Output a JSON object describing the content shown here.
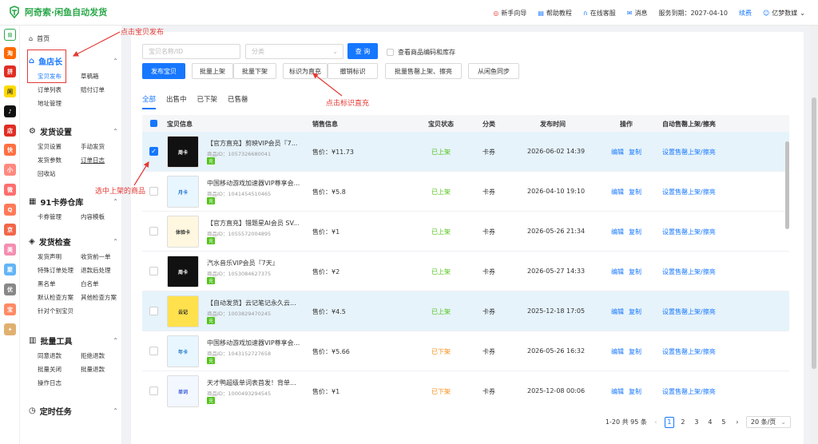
{
  "app": {
    "title": "阿奇索·闲鱼自动发货"
  },
  "topnav": {
    "guide": "新手向导",
    "help": "帮助教程",
    "service": "在线客服",
    "messages": "消息",
    "expiry": "服务到期：2027-04-10",
    "renew": "续费",
    "user": "亿梦数媒"
  },
  "rail": {
    "items": [
      "淘",
      "拼",
      "闲",
      "抖",
      "店",
      "快",
      "小",
      "微",
      "Q",
      "京",
      "美",
      "聚",
      "优",
      "宝"
    ]
  },
  "sidebar": {
    "home": "首页",
    "fish": {
      "title": "鱼店长",
      "items": [
        "宝贝发布",
        "草稿箱",
        "订单列表",
        "赔付订单",
        "地址管理"
      ]
    },
    "ship": {
      "title": "发货设置",
      "items": [
        "宝贝设置",
        "手动发货",
        "发货参数",
        "订单日志",
        "回收站"
      ]
    },
    "card": {
      "title": "91卡券仓库",
      "items": [
        "卡券管理",
        "内容模板"
      ]
    },
    "check": {
      "title": "发货检查",
      "items": [
        "发货声明",
        "收货前一单",
        "特殊订单处理",
        "退款后处理",
        "黑名单",
        "白名单",
        "默认检查方案",
        "其他检查方案",
        "针对个别宝贝"
      ]
    },
    "batch": {
      "title": "批量工具",
      "items": [
        "同意退款",
        "拒绝退款",
        "批量关闭",
        "批量退款",
        "操作日志"
      ]
    },
    "timer": {
      "title": "定时任务"
    }
  },
  "filters": {
    "name_placeholder": "宝贝名称/ID",
    "category_placeholder": "分类",
    "search": "查 询",
    "show_code": "查看商品编码和库存"
  },
  "toolbar": {
    "publish": "发布宝贝",
    "bulk_on": "批量上架",
    "bulk_off": "批量下架",
    "mark_direct": "标识为直充",
    "unmark": "撤销标识",
    "bulk_sold": "批量售罄上架、擦亮",
    "sync": "从闲鱼同步"
  },
  "tabs": [
    "全部",
    "出售中",
    "已下架",
    "已售罄"
  ],
  "table": {
    "headers": {
      "info": "宝贝信息",
      "sale": "销售信息",
      "status": "宝贝状态",
      "category": "分类",
      "time": "发布时间",
      "ops": "操作",
      "auto": "自动售罄上架/擦亮"
    },
    "rows": [
      {
        "name": "【官方直充】剪映VIP会员『7...",
        "pid": "商品ID：1057326680041",
        "price": "售价：¥11.73",
        "status": "已上架",
        "status_color": "#52c41a",
        "cat": "卡券",
        "time": "2026-06-02 14:39",
        "checked": true,
        "thumb": "周卡"
      },
      {
        "name": "中国移动游戏加速器VIP尊享会...",
        "pid": "商品ID：1041454510465",
        "price": "售价：¥5.8",
        "status": "已上架",
        "status_color": "#52c41a",
        "cat": "卡券",
        "time": "2026-04-10 19:10",
        "checked": false,
        "thumb": "月卡"
      },
      {
        "name": "【官方直充】错题星AI会员 SV...",
        "pid": "商品ID：1055572004895",
        "price": "售价：¥1",
        "status": "已上架",
        "status_color": "#52c41a",
        "cat": "卡券",
        "time": "2026-05-26 21:34",
        "checked": false,
        "thumb": "体验卡"
      },
      {
        "name": "汽水音乐VIP会员『7天』",
        "pid": "商品ID：1053084627375",
        "price": "售价：¥2",
        "status": "已上架",
        "status_color": "#52c41a",
        "cat": "卡券",
        "time": "2026-05-27 14:33",
        "checked": false,
        "thumb": "周卡"
      },
      {
        "name": "【自动发货】云记笔记永久云...",
        "pid": "商品ID：1003829470245",
        "price": "售价：¥4.5",
        "status": "已上架",
        "status_color": "#52c41a",
        "cat": "卡券",
        "time": "2025-12-18 17:05",
        "checked": false,
        "thumb": "云记"
      },
      {
        "name": "中国移动游戏加速器VIP尊享会...",
        "pid": "商品ID：1043152727658",
        "price": "售价：¥5.66",
        "status": "已下架",
        "status_color": "#fa8c16",
        "cat": "卡券",
        "time": "2026-05-26 16:32",
        "checked": false,
        "thumb": "年卡"
      },
      {
        "name": "天才鸭超级单词表首发！背单...",
        "pid": "商品ID：1000493294545",
        "price": "售价：¥1",
        "status": "已下架",
        "status_color": "#fa8c16",
        "cat": "卡券",
        "time": "2025-12-08 00:06",
        "checked": false,
        "thumb": "单词"
      }
    ],
    "op_edit": "编辑",
    "op_copy": "复制",
    "auto_label": "设置售罄上架/擦亮"
  },
  "pager": {
    "total": "1-20 共 95 条",
    "prev": "‹",
    "pages": [
      "1",
      "2",
      "3",
      "4",
      "5"
    ],
    "next": "›",
    "size": "20 条/页"
  },
  "annotations": {
    "a1": "点击宝贝发布",
    "a2": "点击标识直充",
    "a3": "选中上架的商品"
  }
}
